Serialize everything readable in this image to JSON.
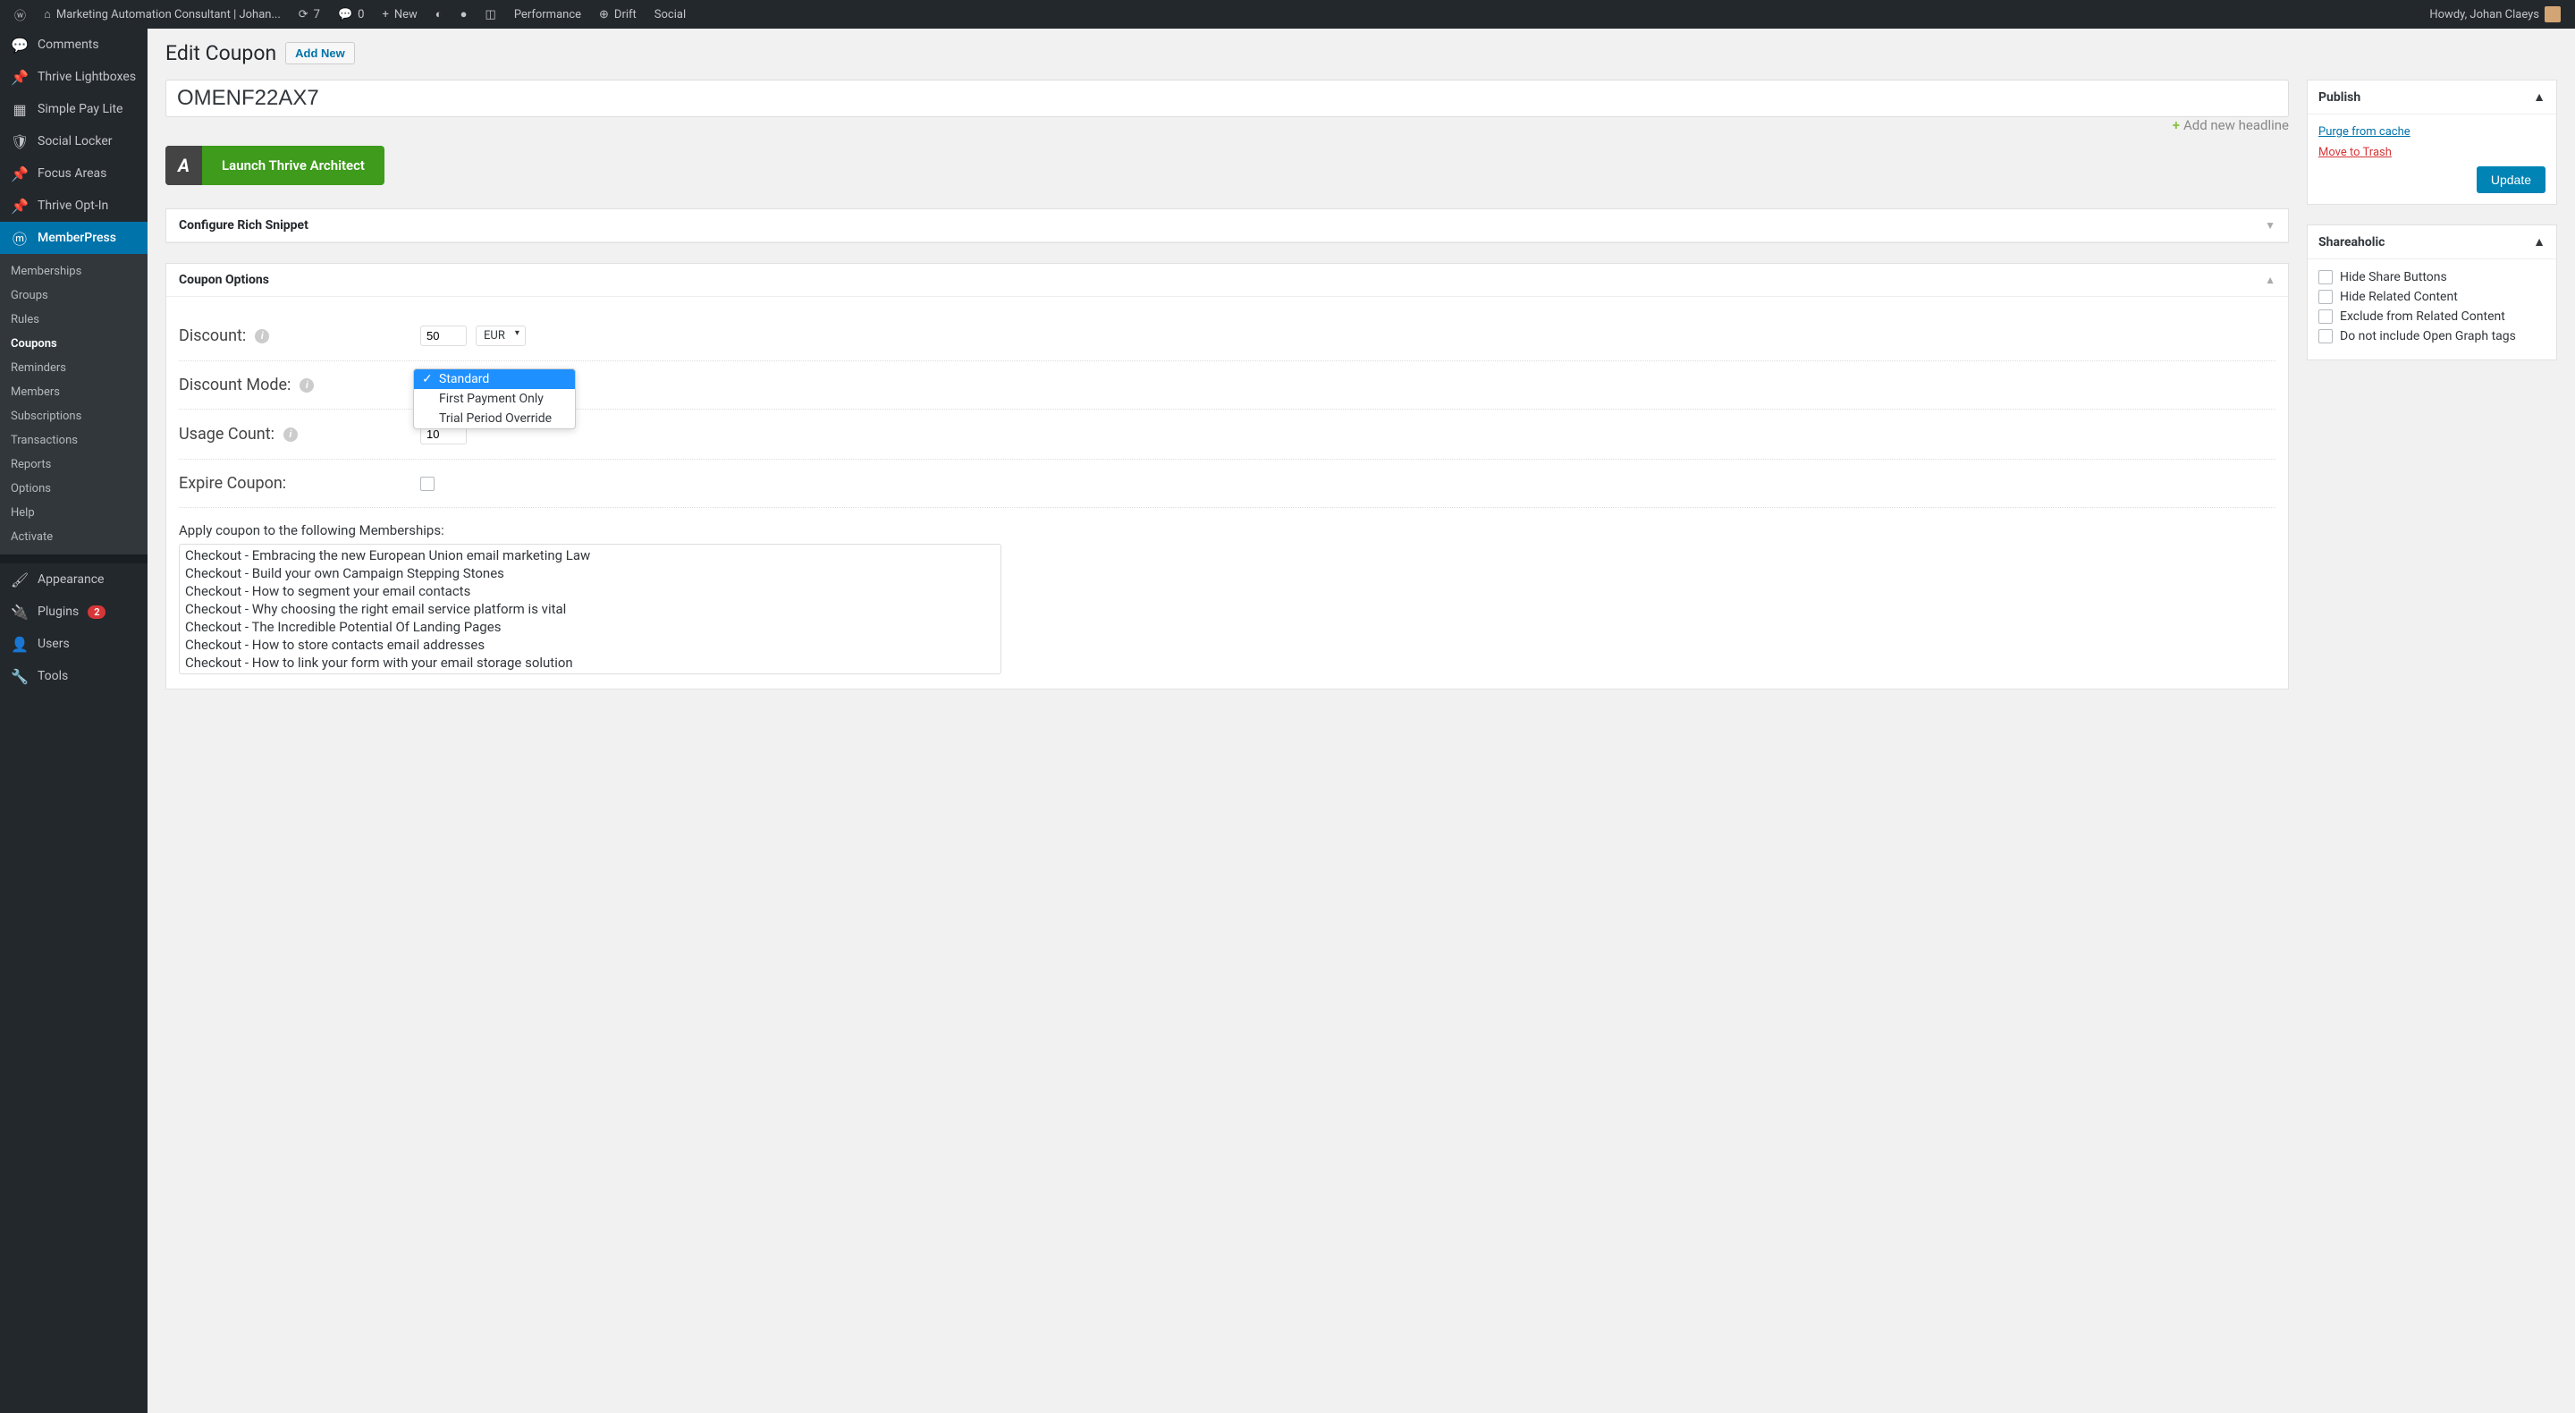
{
  "adminBar": {
    "siteName": "Marketing Automation Consultant | Johan...",
    "updates": "7",
    "comments": "0",
    "new": "New",
    "performance": "Performance",
    "drift": "Drift",
    "social": "Social",
    "greeting": "Howdy, Johan Claeys"
  },
  "sidebar": {
    "items": [
      {
        "label": "Comments"
      },
      {
        "label": "Thrive Lightboxes"
      },
      {
        "label": "Simple Pay Lite"
      },
      {
        "label": "Social Locker"
      },
      {
        "label": "Focus Areas"
      },
      {
        "label": "Thrive Opt-In"
      },
      {
        "label": "MemberPress"
      },
      {
        "label": "Appearance"
      },
      {
        "label": "Plugins"
      },
      {
        "label": "Users"
      },
      {
        "label": "Tools"
      }
    ],
    "submenu": [
      "Memberships",
      "Groups",
      "Rules",
      "Coupons",
      "Reminders",
      "Members",
      "Subscriptions",
      "Transactions",
      "Reports",
      "Options",
      "Help",
      "Activate"
    ],
    "pluginsBadge": "2"
  },
  "page": {
    "title": "Edit Coupon",
    "addNew": "Add New",
    "couponCode": "OMENF22AX7",
    "addHeadline": "Add new headline",
    "thriveLaunch": "Launch Thrive Architect"
  },
  "panels": {
    "richSnippet": "Configure Rich Snippet",
    "couponOptions": "Coupon Options"
  },
  "coupon": {
    "discountLabel": "Discount:",
    "discountValue": "50",
    "currency": "EUR",
    "modeLabel": "Discount Mode:",
    "modeOptions": [
      "Standard",
      "First Payment Only",
      "Trial Period Override"
    ],
    "usageLabel": "Usage Count:",
    "usageValue": "10",
    "expireLabel": "Expire Coupon:",
    "membershipsLabel": "Apply coupon to the following Memberships:",
    "memberships": [
      "Checkout - Embracing the new European Union email marketing Law",
      "Checkout - Build your own Campaign Stepping Stones",
      "Checkout - How to segment your email contacts",
      "Checkout - Why choosing the right email service platform is vital",
      "Checkout - The Incredible Potential Of Landing Pages",
      "Checkout - How to store contacts email addresses",
      "Checkout - How to link your form with your email storage solution"
    ]
  },
  "publish": {
    "title": "Publish",
    "purge": "Purge from cache",
    "trash": "Move to Trash",
    "update": "Update"
  },
  "shareaholic": {
    "title": "Shareaholic",
    "options": [
      "Hide Share Buttons",
      "Hide Related Content",
      "Exclude from Related Content",
      "Do not include Open Graph tags"
    ]
  }
}
